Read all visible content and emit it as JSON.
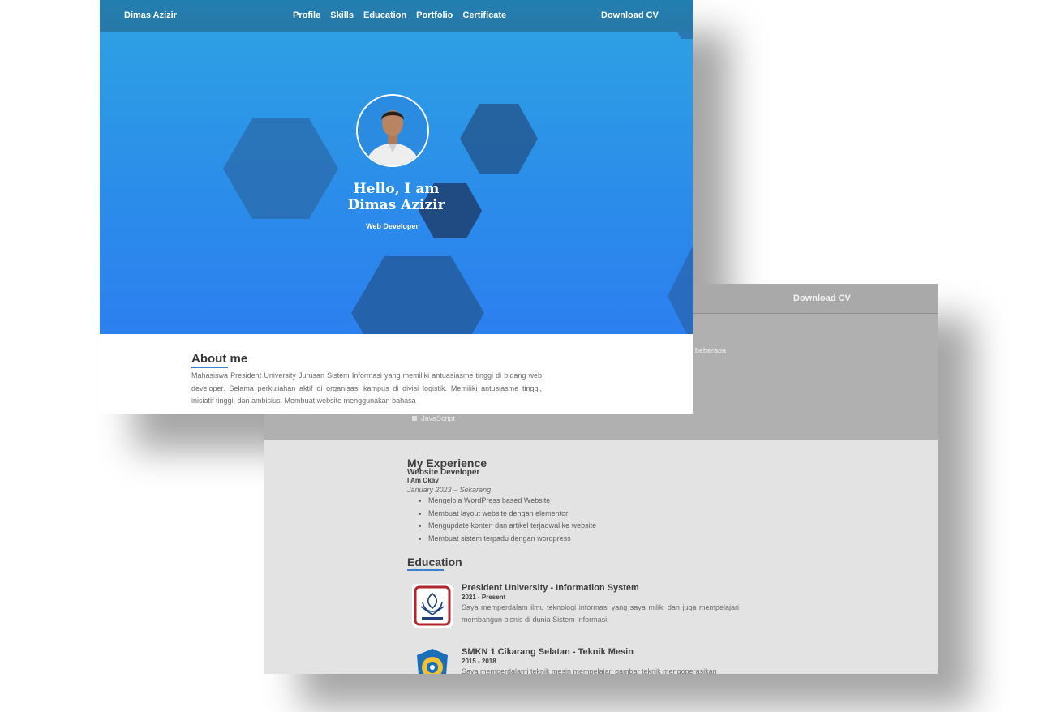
{
  "colors": {
    "accent": "#3b7fcf",
    "hero_top": "#2ea3e3",
    "hero_bottom": "#2c7fef",
    "nav": "#2479aa",
    "hex_dark": "#215f9c"
  },
  "front": {
    "nav": {
      "brand": "Dimas Azizir",
      "links": [
        "Profile",
        "Skills",
        "Education",
        "Portfolio",
        "Certificate"
      ],
      "download": "Download CV"
    },
    "hero": {
      "hello_line1": "Hello, I am",
      "hello_line2": "Dimas Azizir",
      "role": "Web Developer"
    },
    "about": {
      "title": "About me",
      "text": "Mahasiswa President University Jurusan Sistem Informasi yang memiliki antuasiasme tinggi di bidang web developer. Selama perkuliahan aktif di organisasi kampus di divisi logistik. Memiliki antusiasme tinggi, inisiatif tinggi, dan ambisius. Membuat website menggunakan bahasa"
    }
  },
  "back": {
    "nav": {
      "download": "Download CV"
    },
    "fragment": "beberapa",
    "skill_item": "JavaScript",
    "experience": {
      "title": "My Experience",
      "role": "Website Developer",
      "company": "I Am Okay",
      "period": "January 2023 – Sekarang",
      "bullets": [
        "Mengelola WordPress based Website",
        "Membuat layout website dengan elementor",
        "Mengupdate konten dan artikel terjadwal ke website",
        "Membuat sistem terpadu dengan wordpress"
      ]
    },
    "education": {
      "title": "Education",
      "items": [
        {
          "school": "President University - Information System",
          "years": "2021 - Present",
          "desc": "Saya memperdalam ilmu teknologi informasi yang saya miliki dan juga mempelajari membangun bisnis di dunia Sistem Informasi."
        },
        {
          "school": "SMKN 1 Cikarang Selatan - Teknik Mesin",
          "years": "2015 - 2018",
          "desc": "Saya memperdalami teknik mesin mempelajari gambar teknik mengoperasikan"
        }
      ]
    }
  }
}
